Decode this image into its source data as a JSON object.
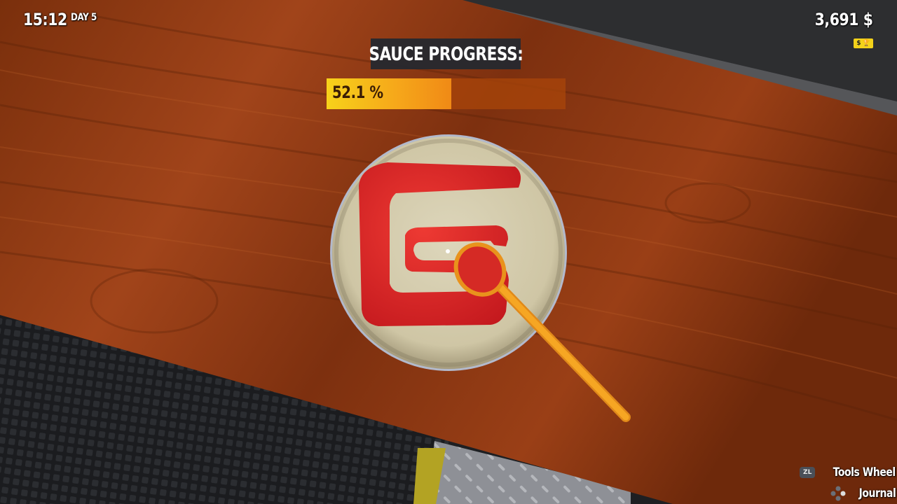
{
  "hud": {
    "time": "15:12",
    "day": "DAY 5",
    "money": "3,691 $",
    "money_badge_left": "$",
    "money_badge_right": "🏆"
  },
  "sauce_progress": {
    "title": "SAUCE PROGRESS:",
    "percent_label": "52.1 %",
    "value": 52.1
  },
  "hints": {
    "tools_button": "ZL",
    "tools_label": "Tools Wheel",
    "journal_label": "Journal",
    "journal_button_icon": "dpad-icon"
  },
  "colors": {
    "progress_fill": "#f6a81a",
    "progress_track": "#aa460a",
    "sauce": "#d81f22",
    "dough": "#d6cdae",
    "spoon": "#f4a21d",
    "table_wood": "#8a3a12"
  }
}
